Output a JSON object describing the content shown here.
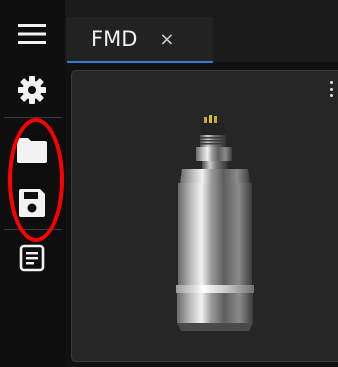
{
  "tabs": [
    {
      "label": "FMD",
      "close_glyph": "×",
      "active": true
    }
  ],
  "toolbar": {
    "icons": [
      "hamburger-menu-icon",
      "gear-icon",
      "folder-icon",
      "floppy-disk-icon",
      "document-icon"
    ]
  },
  "viewer": {
    "object": "cylindrical-sensor-3d-model",
    "menu_icon": "vertical-ellipsis-icon"
  },
  "colors": {
    "background": "#111111",
    "rail": "#0e0e0e",
    "tab_active": "#222222",
    "tab_accent": "#2d7fd6",
    "viewer_bg": "#262626",
    "annotation": "#ff0000"
  }
}
